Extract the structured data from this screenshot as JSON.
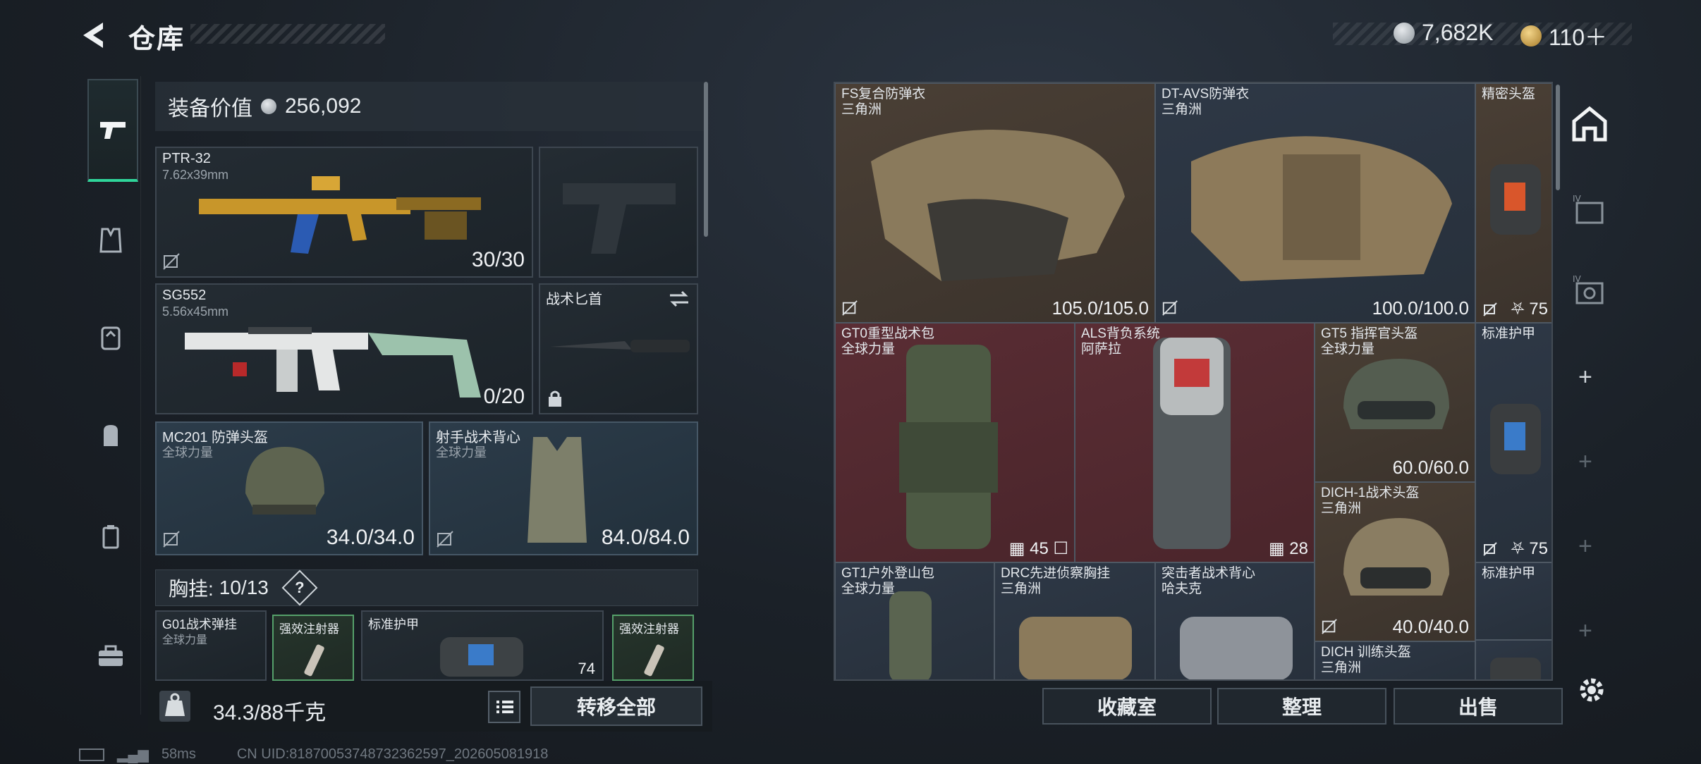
{
  "header": {
    "title": "仓库"
  },
  "currency": {
    "silver": "7,682K",
    "gold": "110＋"
  },
  "loadout": {
    "equip_value_label": "装备价值",
    "equip_value": "256,092",
    "primary": {
      "name": "PTR-32",
      "caliber": "7.62x39mm",
      "ammo": "30/30"
    },
    "secondary": {
      "name": "SG552",
      "caliber": "5.56x45mm",
      "ammo": "0/20"
    },
    "melee": {
      "name": "战术匕首"
    },
    "helmet": {
      "name": "MC201 防弹头盔",
      "faction": "全球力量",
      "durability": "34.0/34.0"
    },
    "armor": {
      "name": "射手战术背心",
      "faction": "全球力量",
      "durability": "84.0/84.0"
    },
    "chest_rig": {
      "label": "胸挂:",
      "count": "10/13",
      "help": "?"
    },
    "rig_items": [
      {
        "name": "G01战术弹挂",
        "sub": "全球力量"
      },
      {
        "name": "强效注射器"
      },
      {
        "name": "标准护甲",
        "badge": "74"
      },
      {
        "name": "强效注射器"
      }
    ],
    "weight": "34.3/88千克",
    "transfer_all": "转移全部"
  },
  "grid": {
    "items": [
      {
        "name": "FS复合防弹衣",
        "sub": "三角洲",
        "value": "105.0/105.0"
      },
      {
        "name": "DT-AVS防弹衣",
        "sub": "三角洲",
        "value": "100.0/100.0"
      },
      {
        "name": "精密头盔",
        "value": "75"
      },
      {
        "name": "GT0重型战术包",
        "sub": "全球力量",
        "value": "45"
      },
      {
        "name": "ALS背负系统",
        "sub": "阿萨拉",
        "value": "28"
      },
      {
        "name": "GT5 指挥官头盔",
        "sub": "全球力量",
        "value": "60.0/60.0"
      },
      {
        "name": "标准护甲",
        "value": "75"
      },
      {
        "name": "DICH-1战术头盔",
        "sub": "三角洲",
        "value": "40.0/40.0"
      },
      {
        "name": "GT1户外登山包",
        "sub": "全球力量"
      },
      {
        "name": "DRC先进侦察胸挂",
        "sub": "三角洲"
      },
      {
        "name": "突击者战术背心",
        "sub": "哈夫克"
      },
      {
        "name": "标准护甲"
      },
      {
        "name": "DICH 训练头盔",
        "sub": "三角洲"
      }
    ]
  },
  "actions": {
    "collection": "收藏室",
    "sort": "整理",
    "sell": "出售"
  },
  "status": {
    "ping": "58ms",
    "uid": "CN UID:81870053748732362597_202605081918"
  }
}
